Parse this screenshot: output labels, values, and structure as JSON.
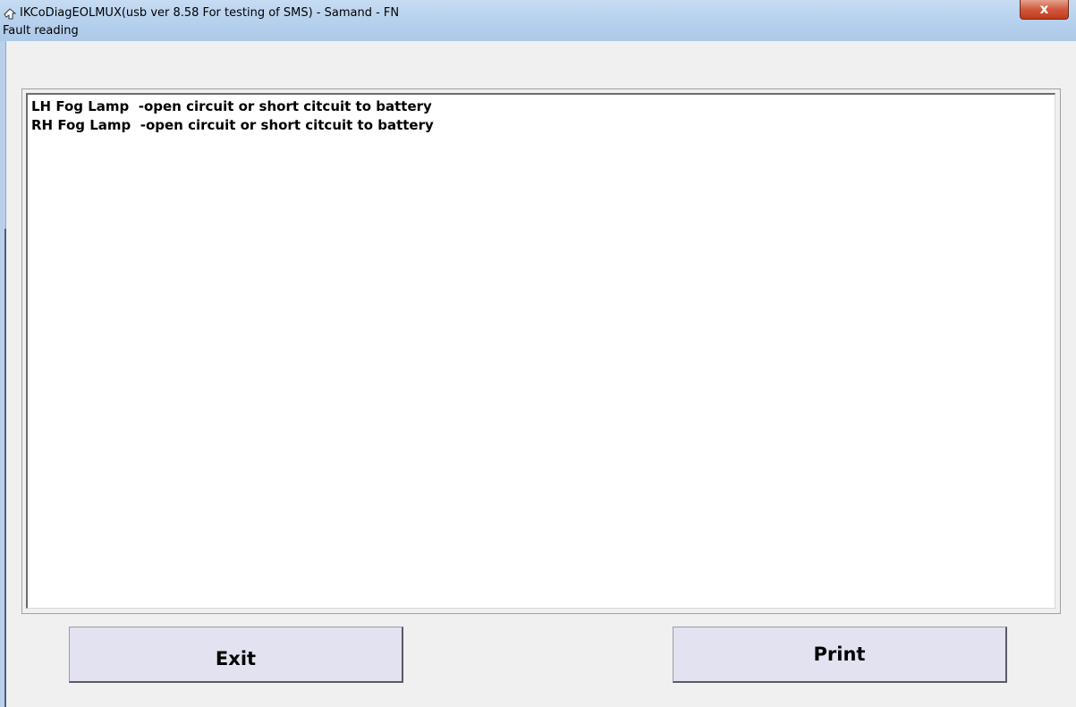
{
  "window": {
    "title": "IKCoDiagEOLMUX(usb ver 8.58 For testing of SMS)  - Samand - FN",
    "close_label": "x",
    "menu_label": "Fault reading"
  },
  "faults": [
    "LH Fog Lamp  -open circuit or short citcuit to battery",
    "RH Fog Lamp  -open circuit or short citcuit to battery"
  ],
  "buttons": {
    "exit_label": "Exit",
    "print_label": "Print"
  },
  "colors": {
    "titlebar": "#b8d2ee",
    "close_button": "#c23a1c",
    "button_face": "#e3e2f1",
    "list_background": "#ffffff",
    "window_background": "#f0f0f0"
  },
  "icons": {
    "title": "app-shape-icon",
    "close": "close-icon"
  }
}
